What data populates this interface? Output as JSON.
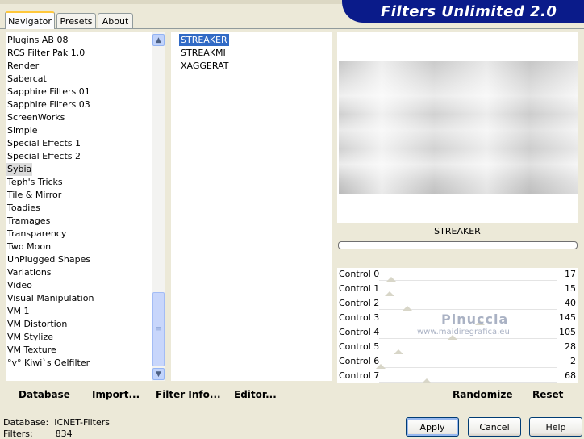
{
  "tabs": [
    {
      "label": "Navigator",
      "active": true
    },
    {
      "label": "Presets",
      "active": false
    },
    {
      "label": "About",
      "active": false
    }
  ],
  "banner": {
    "title": "Filters Unlimited 2.0",
    "color": "#0a1b8a"
  },
  "categories": {
    "items": [
      "Plugins AB 08",
      "RCS Filter Pak 1.0",
      "Render",
      "Sabercat",
      "Sapphire Filters 01",
      "Sapphire Filters 03",
      "ScreenWorks",
      "Simple",
      "Special Effects 1",
      "Special Effects 2",
      "Sybia",
      "Teph's Tricks",
      "Tile & Mirror",
      "Toadies",
      "Tramages",
      "Transparency",
      "Two Moon",
      "UnPlugged Shapes",
      "Variations",
      "Video",
      "Visual Manipulation",
      "VM 1",
      "VM Distortion",
      "VM Stylize",
      "VM Texture",
      "°v° Kiwi`s Oelfilter"
    ],
    "selected": "Sybia",
    "scroll_up_icon": "arrow-up-icon",
    "scroll_down_icon": "arrow-down-icon"
  },
  "filters": {
    "items": [
      "STREAKER",
      "STREAKMI",
      "XAGGERAT"
    ],
    "selected": "STREAKER",
    "selection_color": "#316ac5"
  },
  "preview": {
    "filter_name": "STREAKER",
    "progress": 0
  },
  "controls": [
    {
      "label": "Control 0",
      "value": "17",
      "level": 17
    },
    {
      "label": "Control 1",
      "value": "15",
      "level": 15
    },
    {
      "label": "Control 2",
      "value": "40",
      "level": 40
    },
    {
      "label": "Control 3",
      "value": "145",
      "level": 145
    },
    {
      "label": "Control 4",
      "value": "105",
      "level": 105
    },
    {
      "label": "Control 5",
      "value": "28",
      "level": 28
    },
    {
      "label": "Control 6",
      "value": "2",
      "level": 2
    },
    {
      "label": "Control 7",
      "value": "68",
      "level": 68
    }
  ],
  "watermark": {
    "line1": "Pinuccia",
    "line2": "www.maidiregrafica.eu"
  },
  "left_buttons": {
    "database": {
      "u": "D",
      "rest": "atabase"
    },
    "import": {
      "u": "I",
      "rest": "mport..."
    },
    "filter_info": {
      "pre": "Filter ",
      "u": "I",
      "rest": "nfo..."
    },
    "editor": {
      "u": "E",
      "rest": "ditor..."
    }
  },
  "right_buttons": {
    "randomize": "Randomize",
    "reset": "Reset"
  },
  "status": {
    "database_label": "Database:",
    "database_value": "ICNET-Filters",
    "filters_label": "Filters:",
    "filters_value": "834"
  },
  "dialog_buttons": {
    "apply": "Apply",
    "cancel": "Cancel",
    "help": "Help"
  }
}
